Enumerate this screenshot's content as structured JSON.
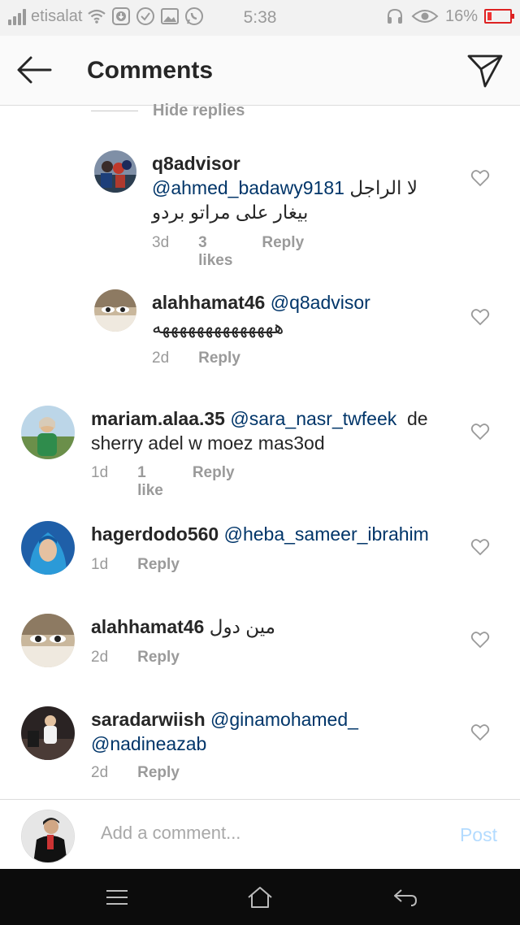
{
  "status": {
    "carrier": "etisalat",
    "time": "5:38",
    "battery": "16%"
  },
  "header": {
    "title": "Comments"
  },
  "hide_replies": "Hide replies",
  "comments": [
    {
      "username": "q8advisor",
      "mention": "@ahmed_badawy9181",
      "text": "لا الراجل",
      "text2": "بيغار على مراتو بردو",
      "time": "3d",
      "likes": "3 likes",
      "reply": "Reply"
    },
    {
      "username": "alahhamat46",
      "mention": "@q8advisor",
      "text": "ههههههههههههههه",
      "time": "2d",
      "reply": "Reply"
    },
    {
      "username": "mariam.alaa.35",
      "mention": "@sara_nasr_twfeek",
      "text": "de",
      "text2": "sherry adel w moez mas3od",
      "time": "1d",
      "likes": "1 like",
      "reply": "Reply"
    },
    {
      "username": "hagerdodo560",
      "mention": "@heba_sameer_ibrahim",
      "time": "1d",
      "reply": "Reply"
    },
    {
      "username": "alahhamat46",
      "text": "مين دول",
      "time": "2d",
      "reply": "Reply"
    },
    {
      "username": "saradarwiish",
      "mention": "@ginamohamed_",
      "mention2": "@nadineazab",
      "time": "2d",
      "reply": "Reply"
    }
  ],
  "add_comment": {
    "placeholder": "Add a comment...",
    "post": "Post"
  },
  "colors": {
    "mention": "#003569",
    "meta": "#9a9a9a",
    "post_disabled": "#b3dbff"
  }
}
